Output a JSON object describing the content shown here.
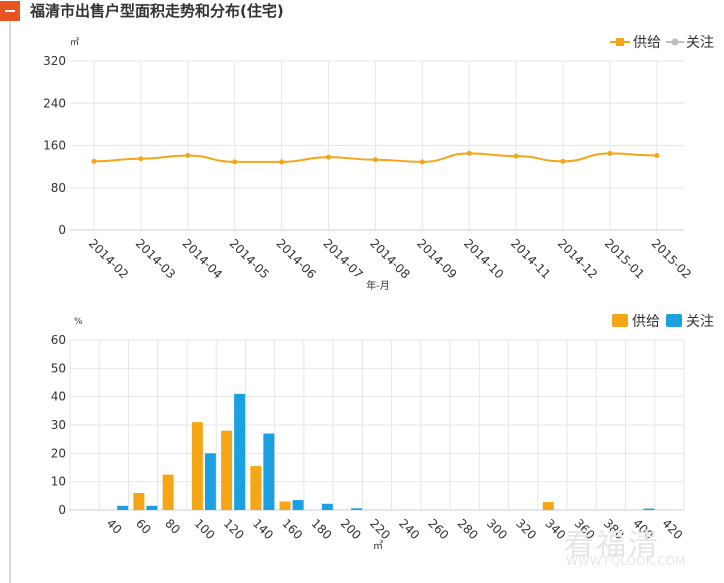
{
  "header": {
    "title": "福清市出售户型面积走势和分布(住宅)"
  },
  "colors": {
    "supply": "#f5a616",
    "attention": "#1ba1e2",
    "attention_line": "#c0c0c0",
    "accent": "#e8541e"
  },
  "watermark": {
    "text": "看福清",
    "url": "WWW.FQLOOK.COM"
  },
  "chart_data": [
    {
      "type": "line",
      "ylabel": "㎡",
      "xlabel": "年-月",
      "ylim": [
        0,
        320
      ],
      "yticks": [
        0,
        80,
        160,
        240,
        320
      ],
      "grid": true,
      "legend": [
        "供给",
        "关注"
      ],
      "legend_position": "top-right",
      "categories": [
        "2014-02",
        "2014-03",
        "2014-04",
        "2014-05",
        "2014-06",
        "2014-07",
        "2014-08",
        "2014-09",
        "2014-10",
        "2014-11",
        "2014-12",
        "2015-01",
        "2015-02"
      ],
      "series": [
        {
          "name": "供给",
          "values": [
            130,
            135,
            141,
            129,
            129,
            138,
            133,
            129,
            145,
            140,
            130,
            145,
            141
          ]
        },
        {
          "name": "关注",
          "values": []
        }
      ]
    },
    {
      "type": "bar",
      "ylabel": "%",
      "xlabel": "㎡",
      "ylim": [
        0,
        60
      ],
      "yticks": [
        0,
        10,
        20,
        30,
        40,
        50,
        60
      ],
      "grid": true,
      "legend": [
        "供给",
        "关注"
      ],
      "legend_position": "top-right",
      "categories": [
        "40",
        "60",
        "80",
        "100",
        "120",
        "140",
        "160",
        "180",
        "200",
        "220",
        "240",
        "260",
        "280",
        "300",
        "320",
        "340",
        "360",
        "380",
        "400",
        "420"
      ],
      "series": [
        {
          "name": "供给",
          "values": [
            0,
            0,
            6,
            12.5,
            31,
            28,
            15.5,
            3,
            0,
            0,
            0,
            0,
            0,
            0,
            0,
            0,
            2.8,
            0,
            0,
            0
          ]
        },
        {
          "name": "关注",
          "values": [
            0,
            1.5,
            1.5,
            0,
            20,
            41,
            27,
            3.5,
            2.2,
            0.6,
            0,
            0,
            0,
            0,
            0,
            0,
            0,
            0,
            0,
            0.5
          ]
        }
      ]
    }
  ]
}
